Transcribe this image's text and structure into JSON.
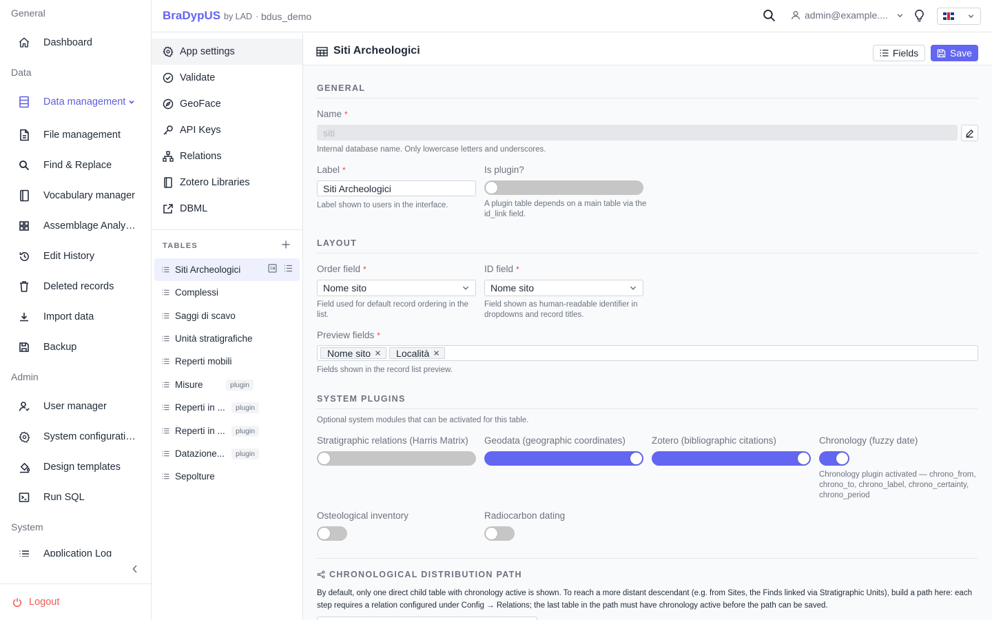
{
  "sidebar": {
    "sections": {
      "general": "General",
      "data": "Data",
      "admin": "Admin",
      "system": "System"
    },
    "items": {
      "dashboard": "Dashboard",
      "data_management": "Data management",
      "file_management": "File management",
      "find_replace": "Find & Replace",
      "vocabulary": "Vocabulary manager",
      "assemblage": "Assemblage Analysis",
      "edit_history": "Edit History",
      "deleted_records": "Deleted records",
      "import_data": "Import data",
      "backup": "Backup",
      "user_manager": "User manager",
      "system_config": "System configuration",
      "design_templates": "Design templates",
      "run_sql": "Run SQL",
      "application_log": "Application Log"
    },
    "logout": "Logout",
    "accent": "#5b5fe0"
  },
  "header": {
    "brand": "BraDypUS",
    "by": "by LAD",
    "sep": "·",
    "database": "bdus_demo",
    "user": "admin@example....",
    "language": "en-GB"
  },
  "settings_menu": {
    "app_settings": "App settings",
    "validate": "Validate",
    "geoface": "GeoFace",
    "api_keys": "API Keys",
    "relations": "Relations",
    "zotero": "Zotero Libraries",
    "dbml": "DBML"
  },
  "tables": {
    "heading": "TABLES",
    "list": [
      {
        "name": "Siti Archeologici",
        "badge": ""
      },
      {
        "name": "Complessi",
        "badge": ""
      },
      {
        "name": "Saggi di scavo",
        "badge": ""
      },
      {
        "name": "Unità stratigrafiche",
        "badge": ""
      },
      {
        "name": "Reperti mobili",
        "badge": ""
      },
      {
        "name": "Misure",
        "badge": "plugin"
      },
      {
        "name": "Reperti in ...",
        "badge": "plugin"
      },
      {
        "name": "Reperti in ...",
        "badge": "plugin"
      },
      {
        "name": "Datazione...",
        "badge": "plugin"
      },
      {
        "name": "Sepolture",
        "badge": ""
      }
    ]
  },
  "main": {
    "title": "Siti Archeologici",
    "fields_btn": "Fields",
    "save_btn": "Save",
    "primary_color": "#6366f1",
    "general": {
      "heading": "GENERAL",
      "name_label": "Name",
      "name_value": "siti",
      "name_hint": "Internal database name. Only lowercase letters and underscores.",
      "label_label": "Label",
      "label_value": "Siti Archeologici",
      "label_hint": "Label shown to users in the interface.",
      "plugin_label": "Is plugin?",
      "plugin_on": false,
      "plugin_hint": "A plugin table depends on a main table via the id_link field."
    },
    "layout": {
      "heading": "LAYOUT",
      "order_label": "Order field",
      "order_value": "Nome sito",
      "order_hint": "Field used for default record ordering in the list.",
      "id_label": "ID field",
      "id_value": "Nome sito",
      "id_hint": "Field shown as human-readable identifier in dropdowns and record titles.",
      "preview_label": "Preview fields",
      "preview_tags": [
        "Nome sito",
        "Località"
      ],
      "preview_hint": "Fields shown in the record list preview."
    },
    "plugins": {
      "heading": "SYSTEM PLUGINS",
      "description": "Optional system modules that can be activated for this table.",
      "stratigraphic": {
        "label": "Stratigraphic relations (Harris Matrix)",
        "on": false
      },
      "geodata": {
        "label": "Geodata (geographic coordinates)",
        "on": true
      },
      "zotero": {
        "label": "Zotero (bibliographic citations)",
        "on": true
      },
      "chronology": {
        "label": "Chronology (fuzzy date)",
        "on": true,
        "hint": "Chronology plugin activated — chrono_from, chrono_to, chrono_label, chrono_certainty, chrono_period"
      },
      "osteological": {
        "label": "Osteological inventory",
        "on": false
      },
      "radiocarbon": {
        "label": "Radiocarbon dating",
        "on": false
      }
    },
    "chrono_path": {
      "heading": "CHRONOLOGICAL DISTRIBUTION PATH",
      "text": "By default, only one direct child table with chronology active is shown. To reach a more distant descendant (e.g. from Sites, the Finds linked via Stratigraphic Units), build a path here: each step requires a relation configured under Config → Relations; the last table in the path must have chronology active before the path can be saved."
    }
  }
}
